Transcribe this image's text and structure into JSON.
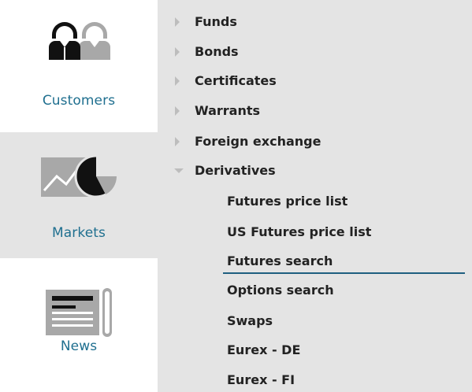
{
  "sidebar": {
    "items": [
      {
        "label": "Customers",
        "icon": "customers-icon",
        "active": false
      },
      {
        "label": "Markets",
        "icon": "markets-chart-icon",
        "active": true
      },
      {
        "label": "News",
        "icon": "newspaper-icon",
        "active": false
      }
    ]
  },
  "tree": {
    "categories": [
      {
        "label": "Funds",
        "expanded": false
      },
      {
        "label": "Bonds",
        "expanded": false
      },
      {
        "label": "Certificates",
        "expanded": false
      },
      {
        "label": "Warrants",
        "expanded": false
      },
      {
        "label": "Foreign exchange",
        "expanded": false
      },
      {
        "label": "Derivatives",
        "expanded": true
      }
    ],
    "derivatives_children": [
      {
        "label": "Futures price list"
      },
      {
        "label": "US Futures price list"
      },
      {
        "label": "Futures search",
        "active": true
      },
      {
        "label": "Options search"
      },
      {
        "label": "Swaps"
      },
      {
        "label": "Eurex - DE"
      },
      {
        "label": "Eurex - FI"
      }
    ]
  },
  "colors": {
    "accent": "#1f6f8f",
    "panel_bg": "#e4e4e4",
    "active_underline": "#1f5f80",
    "text": "#222222"
  }
}
